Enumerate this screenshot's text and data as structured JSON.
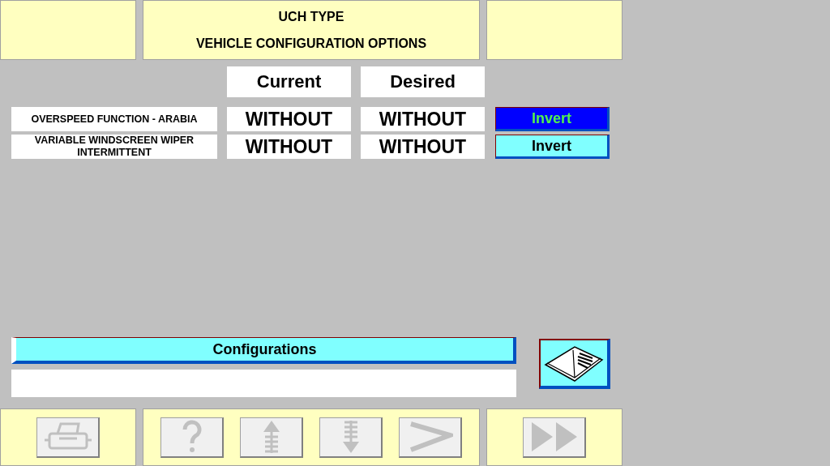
{
  "header": {
    "lines": [
      "UCH TYPE",
      "VEHICLE CONFIGURATION OPTIONS"
    ]
  },
  "columns": [
    "Current",
    "Desired"
  ],
  "options": [
    {
      "label": "OVERSPEED FUNCTION - ARABIA",
      "current": "WITHOUT",
      "desired": "WITHOUT",
      "button": "Invert",
      "selected": true
    },
    {
      "label": "VARIABLE WINDSCREEN WIPER INTERMITTENT",
      "current": "WITHOUT",
      "desired": "WITHOUT",
      "button": "Invert",
      "selected": false
    }
  ],
  "configurations": {
    "label": "Configurations"
  },
  "toolbar": {
    "left": [
      {
        "kind": "print",
        "disabled": true
      }
    ],
    "center": [
      {
        "kind": "help",
        "disabled": true
      },
      {
        "kind": "up",
        "disabled": true
      },
      {
        "kind": "down",
        "disabled": true
      },
      {
        "kind": "next",
        "disabled": true
      }
    ],
    "right": [
      {
        "kind": "forward",
        "disabled": true
      }
    ]
  }
}
